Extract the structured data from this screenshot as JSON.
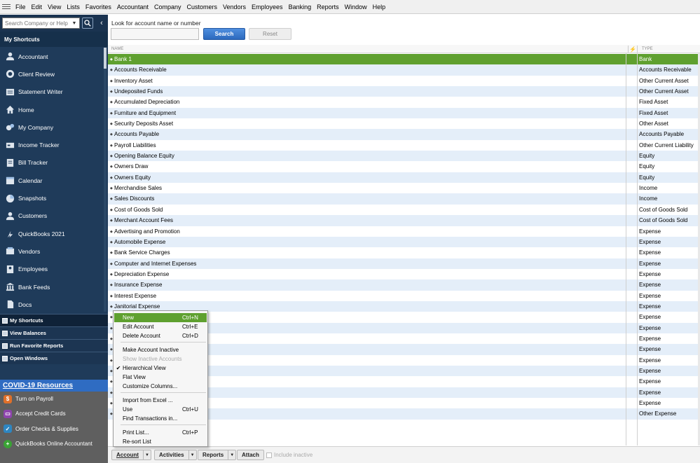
{
  "menubar": {
    "items": [
      "File",
      "Edit",
      "View",
      "Lists",
      "Favorites",
      "Accountant",
      "Company",
      "Customers",
      "Vendors",
      "Employees",
      "Banking",
      "Reports",
      "Window",
      "Help"
    ]
  },
  "sidebar": {
    "search_placeholder": "Search Company or Help",
    "header": "My Shortcuts",
    "shortcuts": [
      {
        "label": "Accountant",
        "icon": "person-icon"
      },
      {
        "label": "Client Review",
        "icon": "client-review-icon"
      },
      {
        "label": "Statement Writer",
        "icon": "statement-icon"
      },
      {
        "label": "Home",
        "icon": "home-icon"
      },
      {
        "label": "My Company",
        "icon": "company-icon"
      },
      {
        "label": "Income Tracker",
        "icon": "income-tracker-icon"
      },
      {
        "label": "Bill Tracker",
        "icon": "bill-tracker-icon"
      },
      {
        "label": "Calendar",
        "icon": "calendar-icon"
      },
      {
        "label": "Snapshots",
        "icon": "pie-chart-icon"
      },
      {
        "label": "Customers",
        "icon": "person-icon"
      },
      {
        "label": "QuickBooks 2021",
        "icon": "arrow-icon"
      },
      {
        "label": "Vendors",
        "icon": "vendors-icon"
      },
      {
        "label": "Employees",
        "icon": "employees-icon"
      },
      {
        "label": "Bank Feeds",
        "icon": "bank-icon"
      },
      {
        "label": "Docs",
        "icon": "docs-icon"
      }
    ],
    "sections": [
      "My Shortcuts",
      "View Balances",
      "Run Favorite Reports",
      "Open Windows"
    ],
    "covid_label": "COVID-19 Resources",
    "promos": [
      {
        "label": "Turn on Payroll",
        "color": "#e0702a"
      },
      {
        "label": "Accept Credit Cards",
        "color": "#8e44ad"
      },
      {
        "label": "Order Checks & Supplies",
        "color": "#2e86c1"
      },
      {
        "label": "QuickBooks Online Accountant",
        "color": "#3aa335"
      }
    ]
  },
  "main": {
    "look_label": "Look for account name or number",
    "search_button": "Search",
    "reset_button": "Reset",
    "columns": {
      "name": "NAME",
      "flag": "⚡",
      "type": "TYPE"
    },
    "accounts": [
      {
        "name": "Bank 1",
        "type": "Bank"
      },
      {
        "name": "Accounts Receivable",
        "type": "Accounts Receivable"
      },
      {
        "name": "Inventory Asset",
        "type": "Other Current Asset"
      },
      {
        "name": "Undeposited Funds",
        "type": "Other Current Asset"
      },
      {
        "name": "Accumulated Depreciation",
        "type": "Fixed Asset"
      },
      {
        "name": "Furniture and Equipment",
        "type": "Fixed Asset"
      },
      {
        "name": "Security Deposits Asset",
        "type": "Other Asset"
      },
      {
        "name": "Accounts Payable",
        "type": "Accounts Payable"
      },
      {
        "name": "Payroll Liabilities",
        "type": "Other Current Liability"
      },
      {
        "name": "Opening Balance Equity",
        "type": "Equity"
      },
      {
        "name": "Owners Draw",
        "type": "Equity"
      },
      {
        "name": "Owners Equity",
        "type": "Equity"
      },
      {
        "name": "Merchandise Sales",
        "type": "Income"
      },
      {
        "name": "Sales Discounts",
        "type": "Income"
      },
      {
        "name": "Cost of Goods Sold",
        "type": "Cost of Goods Sold"
      },
      {
        "name": "Merchant Account Fees",
        "type": "Cost of Goods Sold"
      },
      {
        "name": "Advertising and Promotion",
        "type": "Expense"
      },
      {
        "name": "Automobile Expense",
        "type": "Expense"
      },
      {
        "name": "Bank Service Charges",
        "type": "Expense"
      },
      {
        "name": "Computer and Internet Expenses",
        "type": "Expense"
      },
      {
        "name": "Depreciation Expense",
        "type": "Expense"
      },
      {
        "name": "Insurance Expense",
        "type": "Expense"
      },
      {
        "name": "Interest Expense",
        "type": "Expense"
      },
      {
        "name": "Janitorial Expense",
        "type": "Expense"
      },
      {
        "name": "",
        "type": "Expense"
      },
      {
        "name": "",
        "type": "Expense"
      },
      {
        "name": "",
        "type": "Expense"
      },
      {
        "name": "",
        "type": "Expense"
      },
      {
        "name": "",
        "type": "Expense"
      },
      {
        "name": "",
        "type": "Expense"
      },
      {
        "name": "",
        "type": "Expense"
      },
      {
        "name": "",
        "type": "Expense"
      },
      {
        "name": "",
        "type": "Expense"
      },
      {
        "name": "",
        "type": "Other Expense"
      }
    ],
    "selected_row": "Bank 1"
  },
  "bottom_bar": {
    "account": "Account",
    "activities": "Activities",
    "reports": "Reports",
    "attach": "Attach",
    "include_inactive": "Include inactive"
  },
  "context_menu": {
    "items": [
      {
        "label": "New",
        "shortcut": "Ctrl+N",
        "state": "highlighted"
      },
      {
        "label": "Edit Account",
        "shortcut": "Ctrl+E",
        "state": "normal"
      },
      {
        "label": "Delete Account",
        "shortcut": "Ctrl+D",
        "state": "normal"
      },
      {
        "label": "Make Account Inactive",
        "shortcut": "",
        "state": "normal"
      },
      {
        "label": "Show Inactive Accounts",
        "shortcut": "",
        "state": "disabled"
      },
      {
        "label": "Hierarchical View",
        "shortcut": "",
        "state": "checked"
      },
      {
        "label": "Flat View",
        "shortcut": "",
        "state": "normal"
      },
      {
        "label": "Customize Columns...",
        "shortcut": "",
        "state": "normal"
      },
      {
        "label": "Import from Excel ...",
        "shortcut": "",
        "state": "normal"
      },
      {
        "label": "Use",
        "shortcut": "Ctrl+U",
        "state": "normal"
      },
      {
        "label": "Find Transactions in...",
        "shortcut": "",
        "state": "normal"
      },
      {
        "label": "Print List...",
        "shortcut": "Ctrl+P",
        "state": "normal"
      },
      {
        "label": "Re-sort List",
        "shortcut": "",
        "state": "normal"
      }
    ]
  },
  "colors": {
    "sidebar_bg": "#1f3b5a",
    "selected_row": "#5fa02f",
    "alt_row": "#e4eef9",
    "search_button": "#2c69bd",
    "covid_bar": "#2f6cc2"
  }
}
